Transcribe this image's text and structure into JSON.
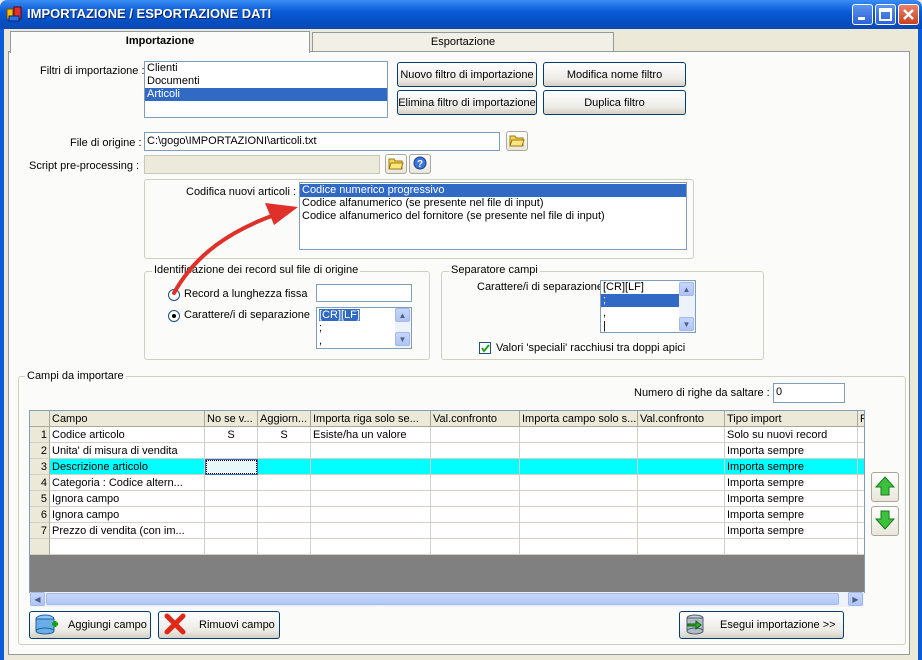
{
  "window": {
    "title": "IMPORTAZIONE / ESPORTAZIONE DATI"
  },
  "tabs": [
    "Importazione",
    "Esportazione"
  ],
  "filters": {
    "label": "Filtri di importazione :",
    "items": [
      "Clienti",
      "Documenti",
      "Articoli"
    ],
    "selected_index": 2,
    "buttons": {
      "new": "Nuovo filtro di importazione",
      "rename": "Modifica nome filtro",
      "delete": "Elimina filtro di importazione",
      "duplicate": "Duplica filtro"
    }
  },
  "source_file": {
    "label": "File di origine :",
    "value": "C:\\gogo\\IMPORTAZIONI\\articoli.txt"
  },
  "script": {
    "label": "Script pre-processing :",
    "value": ""
  },
  "coding": {
    "label": "Codifica nuovi articoli :",
    "items": [
      "Codice numerico progressivo",
      "Codice alfanumerico (se presente nel file di input)",
      "Codice alfanumerico del fornitore (se presente nel file di input)"
    ],
    "selected_index": 0
  },
  "record_id": {
    "title": "Identificazione dei record sul file di origine",
    "fixed_length_label": "Record a lunghezza fissa",
    "fixed_length_value": "",
    "separator_label": "Carattere/i di separazione",
    "separator_items": [
      "[CR][LF]",
      ";",
      ","
    ],
    "selected_option": "separator"
  },
  "field_sep": {
    "title": "Separatore campi",
    "separator_label": "Carattere/i di separazione",
    "separator_items": [
      "[CR][LF]",
      ";",
      ",",
      "|"
    ],
    "selected_index": 1,
    "quotes_label": "Valori 'speciali' racchiusi tra doppi apici",
    "quotes_checked": true
  },
  "fields": {
    "title": "Campi da importare",
    "skip_rows_label": "Numero di righe da saltare :",
    "skip_rows_value": "0",
    "columns": [
      "Campo",
      "No se v...",
      "Aggiorn...",
      "Importa riga solo se...",
      "Val.confronto",
      "Importa campo solo s...",
      "Val.confronto",
      "Tipo import",
      "Para"
    ],
    "rows": [
      {
        "n": "1",
        "cells": [
          "Codice articolo",
          "S",
          "S",
          "Esiste/ha un valore",
          "",
          "",
          "",
          "Solo su nuovi record",
          ""
        ]
      },
      {
        "n": "2",
        "cells": [
          "Unita' di misura di vendita",
          "",
          "",
          "",
          "",
          "",
          "",
          "Importa sempre",
          ""
        ]
      },
      {
        "n": "3",
        "cells": [
          "Descrizione articolo",
          "",
          "",
          "",
          "",
          "",
          "",
          "Importa sempre",
          ""
        ]
      },
      {
        "n": "4",
        "cells": [
          "Categoria : Codice altern...",
          "",
          "",
          "",
          "",
          "",
          "",
          "Importa sempre",
          ""
        ]
      },
      {
        "n": "5",
        "cells": [
          "Ignora campo",
          "",
          "",
          "",
          "",
          "",
          "",
          "Importa sempre",
          ""
        ]
      },
      {
        "n": "6",
        "cells": [
          "Ignora campo",
          "",
          "",
          "",
          "",
          "",
          "",
          "Importa sempre",
          ""
        ]
      },
      {
        "n": "7",
        "cells": [
          "Prezzo di vendita (con im...",
          "",
          "",
          "",
          "",
          "",
          "",
          "Importa sempre",
          ""
        ]
      }
    ],
    "highlighted_row": 3
  },
  "bottom_buttons": {
    "add": "Aggiungi campo",
    "remove": "Rimuovi campo",
    "run": "Esegui importazione >>"
  },
  "colors": {
    "titlebar": "#0a5bd8",
    "selection": "#316ac5",
    "highlight_row": "#00ffff",
    "arrow": "#e0302a"
  },
  "icons": [
    "app-icon",
    "folder-icon",
    "help-icon",
    "arrow-up-icon",
    "arrow-down-icon",
    "add-field-icon",
    "remove-x-icon",
    "run-import-icon"
  ]
}
